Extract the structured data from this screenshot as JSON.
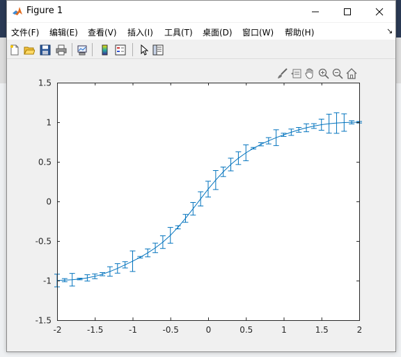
{
  "window": {
    "title": "Figure 1"
  },
  "menubar": {
    "items": [
      "文件(F)",
      "编辑(E)",
      "查看(V)",
      "插入(I)",
      "工具(T)",
      "桌面(D)",
      "窗口(W)",
      "帮助(H)"
    ],
    "dock_arrow": "↘"
  },
  "toolbar": {
    "buttons": [
      "new-figure-icon",
      "open-file-icon",
      "save-icon",
      "print-icon",
      "link-plot-icon",
      "colorbar-icon",
      "legend-icon",
      "edit-plot-arrow-icon",
      "property-inspector-icon"
    ]
  },
  "axes_toolbar": {
    "buttons": [
      "brush-icon",
      "data-tips-icon",
      "pan-hand-icon",
      "zoom-in-icon",
      "zoom-out-icon",
      "restore-view-home-icon"
    ]
  },
  "colors": {
    "line": "#0072BD",
    "axes_bg": "#ffffff",
    "figure_bg": "#f0f0f0",
    "axis_color": "#262626"
  },
  "chart_data": {
    "type": "line",
    "title": "",
    "xlabel": "",
    "ylabel": "",
    "xlim": [
      -2,
      2
    ],
    "ylim": [
      -1.5,
      1.5
    ],
    "xticks": [
      -2,
      -1.5,
      -1,
      -0.5,
      0,
      0.5,
      1,
      1.5,
      2
    ],
    "yticks": [
      -1.5,
      -1,
      -0.5,
      0,
      0.5,
      1,
      1.5
    ],
    "xtick_labels": [
      "-2",
      "-1.5",
      "-1",
      "-0.5",
      "0",
      "0.5",
      "1",
      "1.5",
      "2"
    ],
    "ytick_labels": [
      "-1.5",
      "-1",
      "-0.5",
      "0",
      "0.5",
      "1",
      "1.5"
    ],
    "grid": false,
    "series": [
      {
        "style": "line with vertical error bars",
        "x": [
          -2.0,
          -1.9,
          -1.8,
          -1.7,
          -1.6,
          -1.5,
          -1.4,
          -1.3,
          -1.2,
          -1.1,
          -1.0,
          -0.9,
          -0.8,
          -0.7,
          -0.6,
          -0.5,
          -0.4,
          -0.3,
          -0.2,
          -0.1,
          0.0,
          0.1,
          0.2,
          0.3,
          0.4,
          0.5,
          0.6,
          0.7,
          0.8,
          0.9,
          1.0,
          1.1,
          1.2,
          1.3,
          1.4,
          1.5,
          1.6,
          1.7,
          1.8,
          1.9,
          2.0
        ],
        "y": [
          -0.999,
          -0.995,
          -0.989,
          -0.98,
          -0.966,
          -0.946,
          -0.919,
          -0.885,
          -0.846,
          -0.801,
          -0.755,
          -0.705,
          -0.65,
          -0.587,
          -0.514,
          -0.428,
          -0.327,
          -0.214,
          -0.093,
          0.032,
          0.155,
          0.27,
          0.374,
          0.466,
          0.546,
          0.614,
          0.672,
          0.722,
          0.766,
          0.805,
          0.841,
          0.874,
          0.904,
          0.93,
          0.952,
          0.969,
          0.982,
          0.99,
          0.996,
          0.999,
          1.0
        ],
        "err": [
          0.08,
          0.02,
          0.08,
          0.01,
          0.04,
          0.03,
          0.02,
          0.06,
          0.06,
          0.04,
          0.13,
          0.01,
          0.05,
          0.06,
          0.08,
          0.1,
          0.02,
          0.05,
          0.08,
          0.09,
          0.1,
          0.12,
          0.06,
          0.08,
          0.08,
          0.1,
          0.01,
          0.02,
          0.04,
          0.1,
          0.02,
          0.04,
          0.03,
          0.05,
          0.03,
          0.07,
          0.12,
          0.13,
          0.11,
          0.02,
          0.01
        ]
      }
    ]
  }
}
